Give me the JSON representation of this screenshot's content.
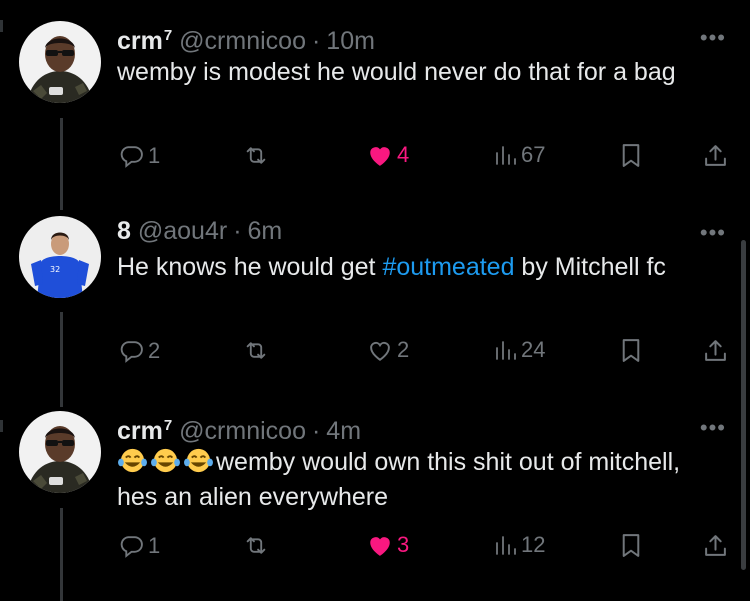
{
  "tweets": [
    {
      "name": "crm",
      "name_sup": "7",
      "handle": "@crmnicoo",
      "separator": "·",
      "time": "10m",
      "text": "wemby is modest he would never do that for a bag",
      "counts": {
        "replies": "1",
        "retweets": "",
        "likes": "4",
        "views": "67"
      },
      "liked": true
    },
    {
      "name": "8",
      "name_sup": "",
      "handle": "@aou4r",
      "separator": "·",
      "time": "6m",
      "text_before": "He knows he would get ",
      "hashtag": "#outmeated",
      "text_after": " by Mitchell fc",
      "counts": {
        "replies": "2",
        "retweets": "",
        "likes": "2",
        "views": "24"
      },
      "liked": false,
      "avatar_jersey_number": "32"
    },
    {
      "name": "crm",
      "name_sup": "7",
      "handle": "@crmnicoo",
      "separator": "·",
      "time": "4m",
      "emojis": [
        "😂",
        "😂",
        "😂"
      ],
      "text": "wemby would own this shit out of mitchell, hes an alien everywhere",
      "counts": {
        "replies": "1",
        "retweets": "",
        "likes": "3",
        "views": "12"
      },
      "liked": true
    }
  ],
  "more_label": "•••",
  "colors": {
    "background": "#000000",
    "text": "#e7e9ea",
    "muted": "#71767b",
    "like": "#f91880",
    "hashtag": "#1d9bf0"
  },
  "icons": [
    "reply-icon",
    "retweet-icon",
    "heart-icon",
    "views-icon",
    "bookmark-icon",
    "share-icon",
    "more-icon"
  ]
}
